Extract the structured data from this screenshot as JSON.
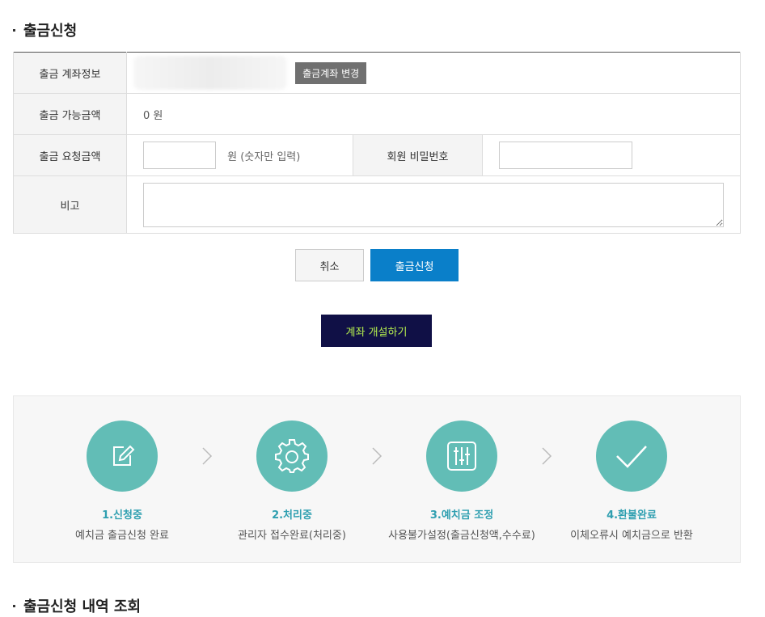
{
  "page": {
    "title": "출금신청",
    "history_title": "출금신청 내역 조회"
  },
  "form": {
    "account_label": "출금 계좌정보",
    "change_account_button": "출금계좌 변경",
    "available_label": "출금 가능금액",
    "available_value": "0 원",
    "request_label": "출금 요청금액",
    "request_value": "",
    "request_unit_hint": "원  (숫자만 입력)",
    "password_label": "회원 비밀번호",
    "password_value": "",
    "memo_label": "비고",
    "memo_value": ""
  },
  "buttons": {
    "cancel": "취소",
    "submit": "출금신청",
    "open_account": "계좌 개설하기"
  },
  "steps": [
    {
      "title": "1.신청중",
      "desc": "예치금 출금신청 완료",
      "icon": "edit-icon"
    },
    {
      "title": "2.처리중",
      "desc": "관리자 접수완료(처리중)",
      "icon": "gear-icon"
    },
    {
      "title": "3.예치금 조정",
      "desc": "사용불가설정(출금신청액,수수료)",
      "icon": "sliders-icon"
    },
    {
      "title": "4.환불완료",
      "desc": "이체오류시 예치금으로 반환",
      "icon": "check-icon"
    }
  ],
  "colors": {
    "step_circle": "#62bdb6",
    "step_title": "#2f9fb0",
    "submit_button": "#0a7fc9",
    "open_account_button": "#101046",
    "open_account_text": "#b6f04e"
  }
}
